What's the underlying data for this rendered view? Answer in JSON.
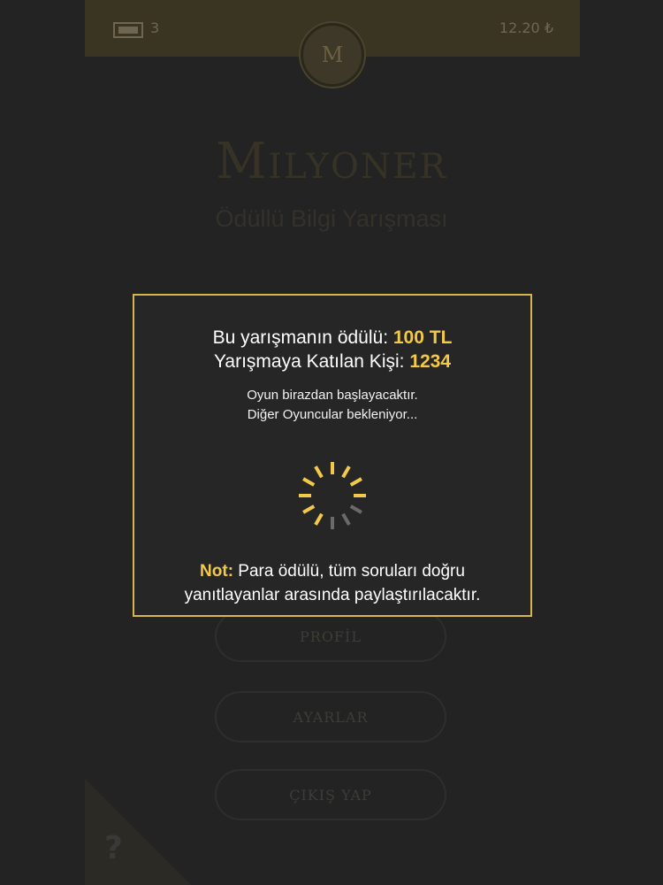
{
  "header": {
    "ticket_count": "3",
    "coin_display": "12.20 ₺",
    "avatar_initial": "M"
  },
  "logo": {
    "title": "Milyoner",
    "subtitle": "Ödüllü Bilgi Yarışması"
  },
  "menu": {
    "profile": "PROFİL",
    "settings": "AYARLAR",
    "logout": "ÇIKIŞ YAP"
  },
  "help": {
    "icon": "question-mark-icon",
    "glyph": "?"
  },
  "modal": {
    "prize_label": "Bu yarışmanın ödülü: ",
    "prize_value": "100 TL",
    "participants_label": "Yarışmaya Katılan Kişi: ",
    "participants_value": "1234",
    "message_1": "Oyun birazdan başlayacaktır.",
    "message_2": "Diğer Oyuncular bekleniyor...",
    "note_label": "Not:",
    "note_text": " Para ödülü, tüm soruları doğru",
    "note_text_2": "yanıtlayanlar arasında paylaştırılacaktır."
  },
  "colors": {
    "accent_gold": "#f3c94a",
    "modal_border": "#d6b54c",
    "background": "#232323"
  }
}
